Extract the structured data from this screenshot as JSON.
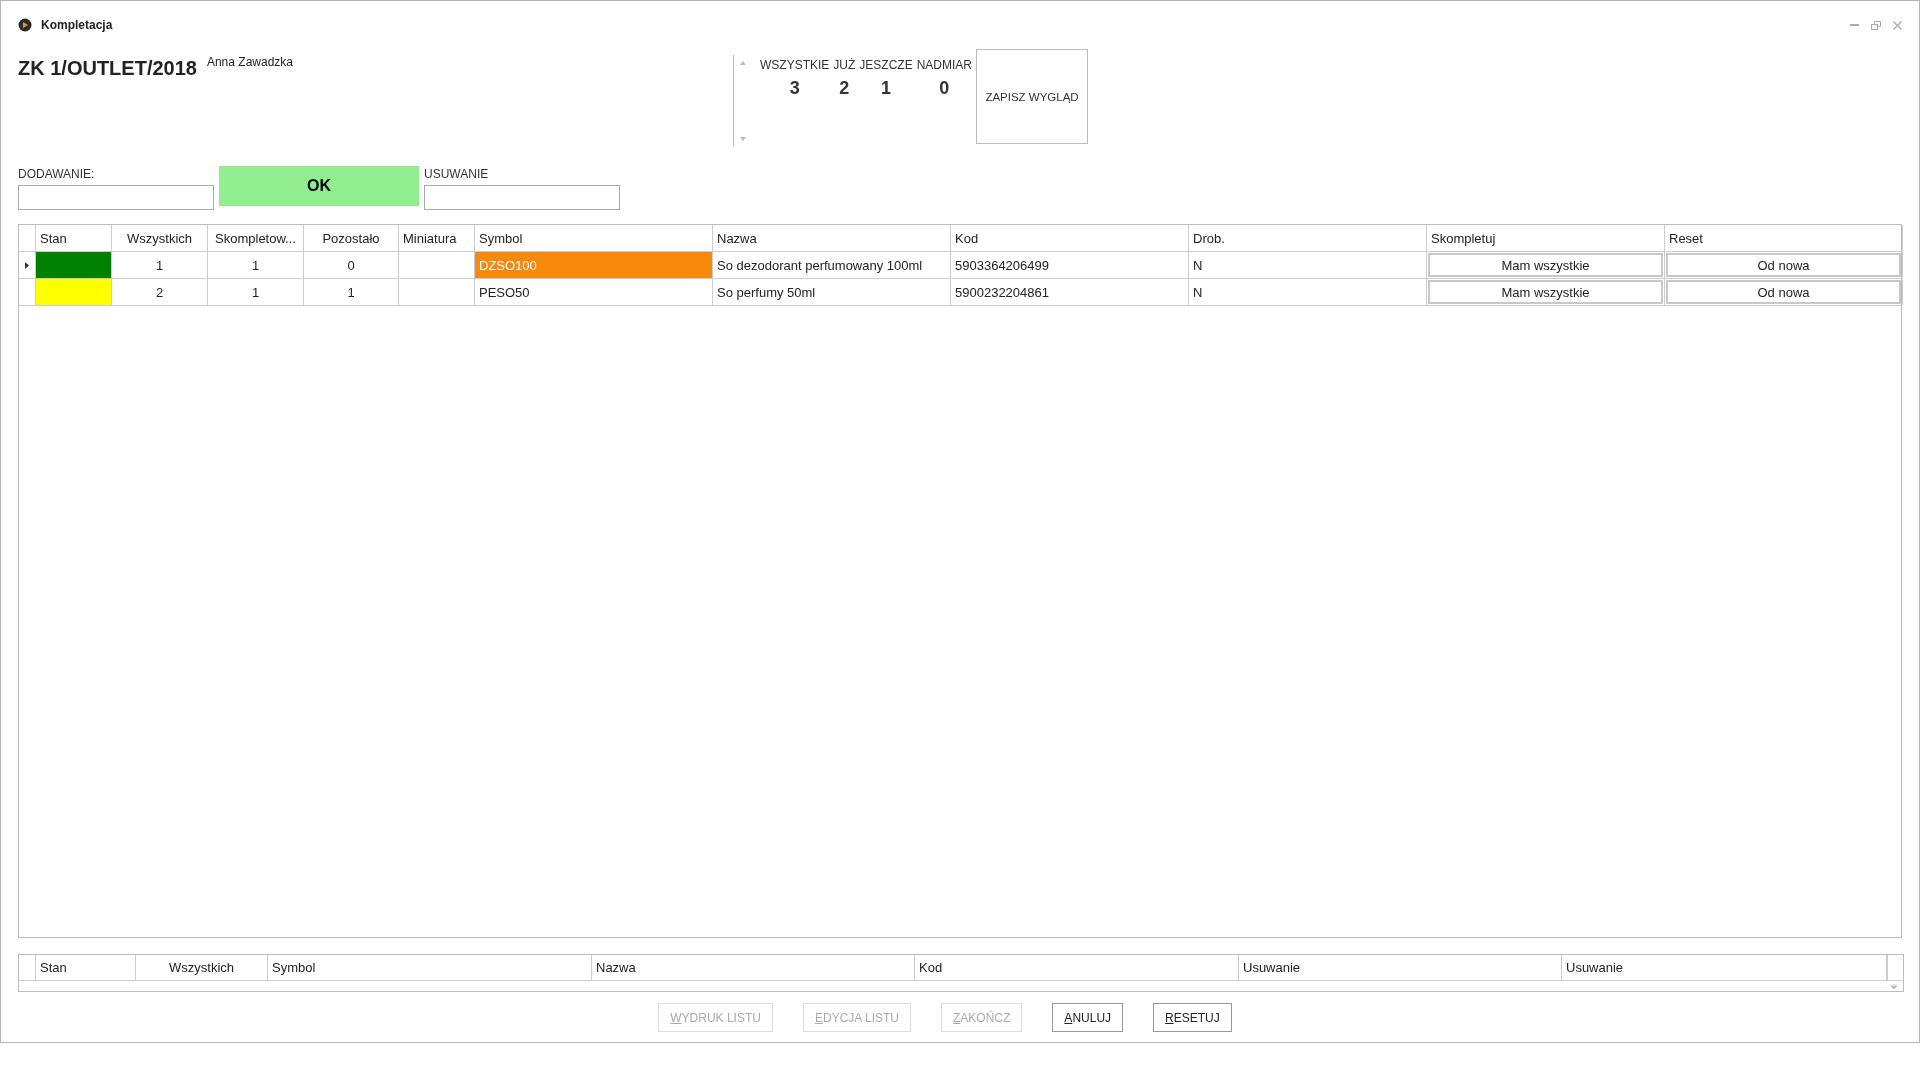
{
  "window": {
    "title": "Kompletacja"
  },
  "header": {
    "document": "ZK 1/OUTLET/2018",
    "user": "Anna Zawadzka"
  },
  "counters": [
    {
      "label": "WSZYSTKIE",
      "value": "3"
    },
    {
      "label": "JUŻ",
      "value": "2"
    },
    {
      "label": "JESZCZE",
      "value": "1"
    },
    {
      "label": "NADMIAR",
      "value": "0"
    }
  ],
  "save_layout_button": "ZAPISZ WYGLĄD",
  "add_field": {
    "label": "DODAWANIE:"
  },
  "ok_button": "OK",
  "remove_field": {
    "label": "USUWANIE"
  },
  "table": {
    "columns": [
      "Stan",
      "Wszystkich",
      "Skompletow...",
      "Pozostało",
      "Miniatura",
      "Symbol",
      "Nazwa",
      "Kod",
      "Drob.",
      "Skompletuj",
      "Reset"
    ],
    "rows": [
      {
        "selected": true,
        "color": "#008000",
        "total": "1",
        "completed": "1",
        "remaining": "0",
        "symbol": "DZSO100",
        "symbol_highlighted": true,
        "name": "So dezodorant perfumowany 100ml",
        "code": "5903364206499",
        "drob": "N",
        "complete_button": "Mam wszystkie",
        "reset_button": "Od nowa"
      },
      {
        "selected": false,
        "color": "#ffff00",
        "total": "2",
        "completed": "1",
        "remaining": "1",
        "symbol": "PESO50",
        "symbol_highlighted": false,
        "name": "So perfumy 50ml",
        "code": "5900232204861",
        "drob": "N",
        "complete_button": "Mam wszystkie",
        "reset_button": "Od nowa"
      }
    ]
  },
  "removed_table": {
    "columns": [
      "Stan",
      "Wszystkich",
      "Symbol",
      "Nazwa",
      "Kod",
      "Usuwanie",
      "Usuwanie"
    ]
  },
  "buttons": [
    {
      "label": "WYDRUK LISTU",
      "disabled": true
    },
    {
      "label": "EDYCJA LISTU",
      "disabled": true
    },
    {
      "label": "ZAKOŃCZ",
      "disabled": true
    },
    {
      "label": "ANULUJ",
      "disabled": false
    },
    {
      "label": "RESETUJ",
      "disabled": false
    }
  ]
}
